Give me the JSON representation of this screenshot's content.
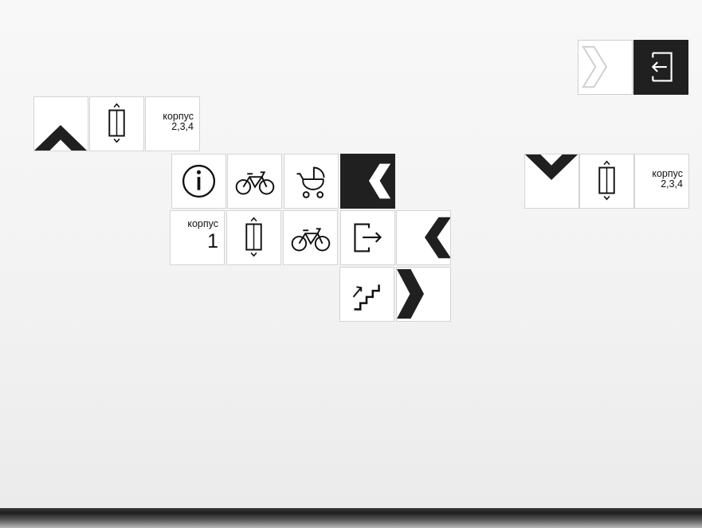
{
  "signs": {
    "group_a": {
      "label_word": "корпус",
      "label_numbers": "2,3,4"
    },
    "group_b": {
      "label_word": "корпус",
      "label_numbers": "1"
    },
    "group_c": {
      "label_word": "корпус",
      "label_numbers": "2,3,4"
    }
  },
  "icons": [
    "arrow-right-light-icon",
    "exit-icon",
    "arrow-up-icon",
    "elevator-icon",
    "info-icon",
    "bicycle-icon",
    "stroller-icon",
    "arrow-left-icon",
    "exit-icon",
    "stairs-up-icon",
    "arrow-right-icon",
    "arrow-down-icon"
  ],
  "colors": {
    "tile": "#ffffff",
    "dark_tile": "#202020",
    "ink": "#111111",
    "wall": "#f3f3f3"
  }
}
